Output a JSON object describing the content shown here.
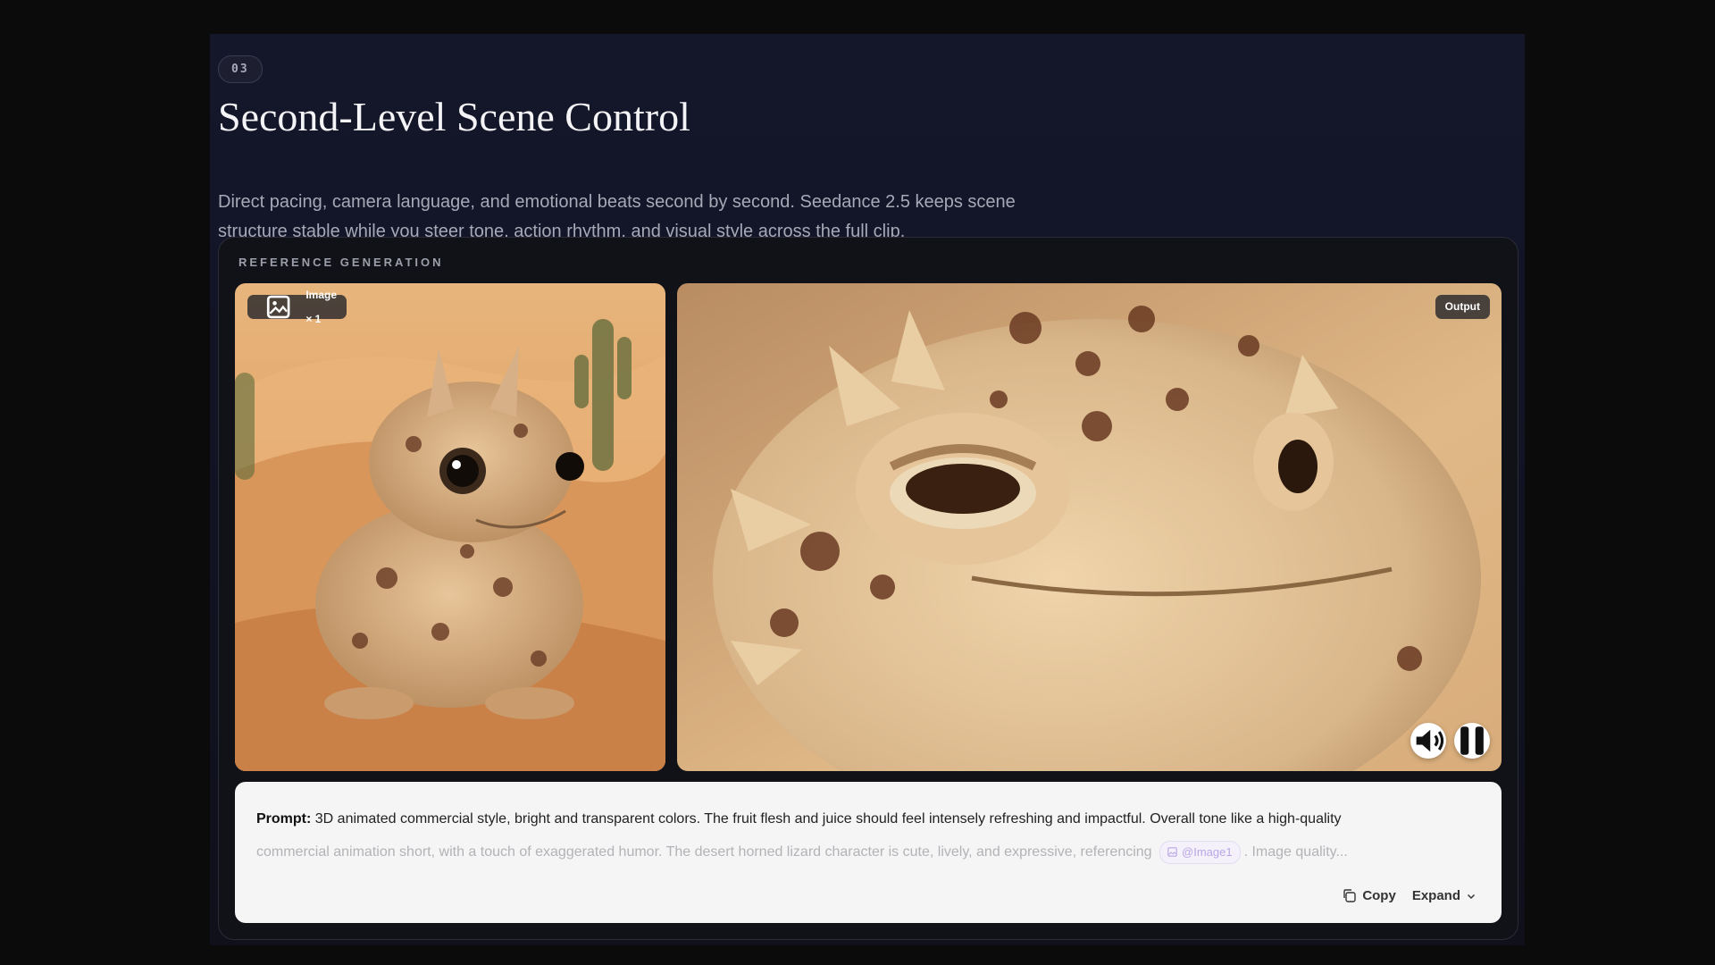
{
  "section": {
    "step": "03",
    "title": "Second-Level Scene Control",
    "description": "Direct pacing, camera language, and emotional beats second by second. Seedance 2.5 keeps scene structure stable while you steer tone, action rhythm, and visual style across the full clip."
  },
  "panel": {
    "label": "REFERENCE GENERATION",
    "reference_chip": "Image × 1",
    "output_chip": "Output",
    "controls": {
      "sound_icon": "speaker-icon",
      "pause_icon": "pause-icon"
    }
  },
  "prompt": {
    "label": "Prompt:",
    "line1": "3D animated commercial style, bright and transparent colors. The fruit flesh and juice should feel intensely refreshing and impactful. Overall tone like a high-quality",
    "line2": "commercial animation short, with a touch of exaggerated humor. The desert horned lizard character is cute, lively, and expressive, referencing",
    "mention": "@Image1",
    "line2_tail": ". Image quality...",
    "copy_label": "Copy",
    "expand_label": "Expand"
  },
  "colors": {
    "page_bg": "#0b0b0c",
    "section_bg": "#14162a",
    "panel_bg": "#111218",
    "prompt_bg": "#f5f5f6",
    "mention_fg": "#b9a6e6"
  }
}
